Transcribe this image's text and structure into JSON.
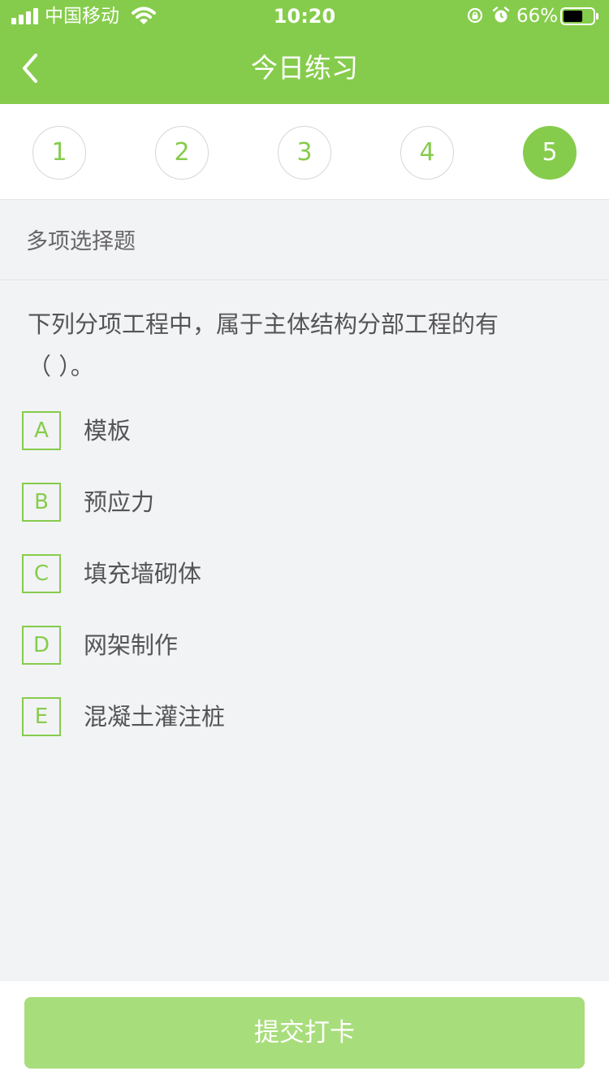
{
  "status_bar": {
    "carrier": "中国移动",
    "time": "10:20",
    "battery": "66%",
    "battery_level": 66
  },
  "header": {
    "title": "今日练习"
  },
  "question_tabs": [
    {
      "label": "1"
    },
    {
      "label": "2"
    },
    {
      "label": "3"
    },
    {
      "label": "4"
    },
    {
      "label": "5"
    }
  ],
  "active_tab": "5",
  "question": {
    "type": "多项选择题",
    "text_line1": "下列分项工程中，属于主体结构分部工程的有",
    "text_line2": "（    ）。",
    "options": [
      {
        "key": "A",
        "text": "模板"
      },
      {
        "key": "B",
        "text": "预应力"
      },
      {
        "key": "C",
        "text": "填充墙砌体"
      },
      {
        "key": "D",
        "text": "网架制作"
      },
      {
        "key": "E",
        "text": "混凝土灌注桩"
      }
    ]
  },
  "footer": {
    "submit_label": "提交打卡"
  },
  "colors": {
    "accent": "#86cc4c",
    "submit_disabled": "#a8dd7b",
    "background": "#f2f3f5"
  },
  "icons": [
    "signal-icon",
    "wifi-icon",
    "orientation-lock-icon",
    "alarm-icon",
    "battery-icon",
    "back-chevron-icon"
  ]
}
